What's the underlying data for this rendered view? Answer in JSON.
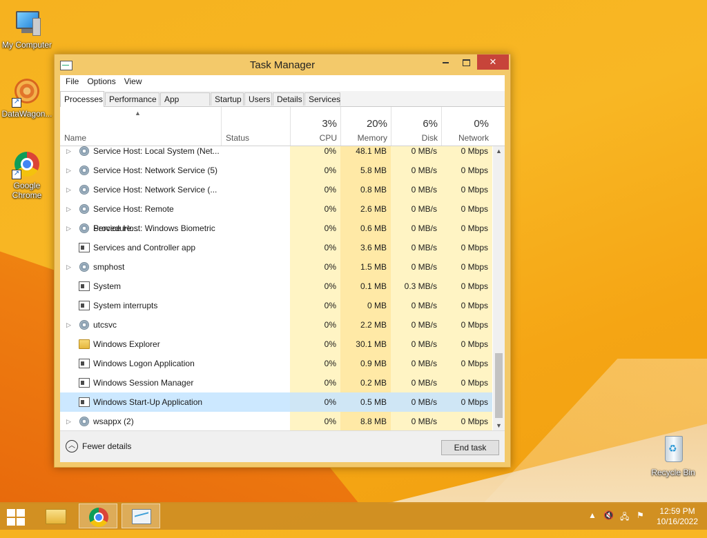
{
  "desktop": {
    "icons": [
      {
        "label": "My Computer"
      },
      {
        "label": "DataWagon..."
      },
      {
        "label_line1": "Google",
        "label_line2": "Chrome"
      },
      {
        "label": "Recycle Bin"
      }
    ]
  },
  "window": {
    "title": "Task Manager",
    "close_glyph": "✕",
    "menu": [
      "File",
      "Options",
      "View"
    ],
    "tabs": [
      "Processes",
      "Performance",
      "App history",
      "Startup",
      "Users",
      "Details",
      "Services"
    ],
    "active_tab": "Processes",
    "columns": {
      "name": "Name",
      "status": "Status",
      "cpu": {
        "pct": "3%",
        "label": "CPU"
      },
      "memory": {
        "pct": "20%",
        "label": "Memory"
      },
      "disk": {
        "pct": "6%",
        "label": "Disk"
      },
      "network": {
        "pct": "0%",
        "label": "Network"
      }
    },
    "rows": [
      {
        "name": "Service Host: Local System (Net...",
        "expandable": true,
        "icon": "gear-icon",
        "cpu": "0%",
        "memory": "48.1 MB",
        "disk": "0 MB/s",
        "network": "0 Mbps"
      },
      {
        "name": "Service Host: Network Service (5)",
        "expandable": true,
        "icon": "gear-icon",
        "cpu": "0%",
        "memory": "5.8 MB",
        "disk": "0 MB/s",
        "network": "0 Mbps"
      },
      {
        "name": "Service Host: Network Service (...",
        "expandable": true,
        "icon": "gear-icon",
        "cpu": "0%",
        "memory": "0.8 MB",
        "disk": "0 MB/s",
        "network": "0 Mbps"
      },
      {
        "name": "Service Host: Remote Procedure...",
        "expandable": true,
        "icon": "gear-icon",
        "cpu": "0%",
        "memory": "2.6 MB",
        "disk": "0 MB/s",
        "network": "0 Mbps"
      },
      {
        "name": "Service Host: Windows Biometric",
        "expandable": true,
        "icon": "gear-icon",
        "cpu": "0%",
        "memory": "0.6 MB",
        "disk": "0 MB/s",
        "network": "0 Mbps"
      },
      {
        "name": "Services and Controller app",
        "expandable": false,
        "icon": "app-window-icon",
        "cpu": "0%",
        "memory": "3.6 MB",
        "disk": "0 MB/s",
        "network": "0 Mbps"
      },
      {
        "name": "smphost",
        "expandable": true,
        "icon": "gear-icon",
        "cpu": "0%",
        "memory": "1.5 MB",
        "disk": "0 MB/s",
        "network": "0 Mbps"
      },
      {
        "name": "System",
        "expandable": false,
        "icon": "app-window-icon",
        "cpu": "0%",
        "memory": "0.1 MB",
        "disk": "0.3 MB/s",
        "network": "0 Mbps"
      },
      {
        "name": "System interrupts",
        "expandable": false,
        "icon": "app-window-icon",
        "cpu": "0%",
        "memory": "0 MB",
        "disk": "0 MB/s",
        "network": "0 Mbps"
      },
      {
        "name": "utcsvc",
        "expandable": true,
        "icon": "gear-icon",
        "cpu": "0%",
        "memory": "2.2 MB",
        "disk": "0 MB/s",
        "network": "0 Mbps"
      },
      {
        "name": "Windows Explorer",
        "expandable": false,
        "icon": "folder-icon",
        "cpu": "0%",
        "memory": "30.1 MB",
        "disk": "0 MB/s",
        "network": "0 Mbps"
      },
      {
        "name": "Windows Logon Application",
        "expandable": false,
        "icon": "app-window-icon",
        "cpu": "0%",
        "memory": "0.9 MB",
        "disk": "0 MB/s",
        "network": "0 Mbps"
      },
      {
        "name": "Windows Session Manager",
        "expandable": false,
        "icon": "app-window-icon",
        "cpu": "0%",
        "memory": "0.2 MB",
        "disk": "0 MB/s",
        "network": "0 Mbps"
      },
      {
        "name": "Windows Start-Up Application",
        "expandable": false,
        "icon": "app-window-icon",
        "cpu": "0%",
        "memory": "0.5 MB",
        "disk": "0 MB/s",
        "network": "0 Mbps",
        "selected": true
      },
      {
        "name": "wsappx (2)",
        "expandable": true,
        "icon": "gear-icon",
        "cpu": "0%",
        "memory": "8.8 MB",
        "disk": "0 MB/s",
        "network": "0 Mbps"
      }
    ],
    "footer": {
      "fewer_details": "Fewer details",
      "end_task": "End task"
    }
  },
  "taskbar": {
    "clock_time": "12:59 PM",
    "clock_date": "10/16/2022"
  },
  "colors": {
    "selection": "#cce8ff",
    "cpu_column": "#fff4c4",
    "memory_column": "#ffe9a6",
    "close_button": "#c7443a",
    "taskbar": "#ce8e24"
  }
}
